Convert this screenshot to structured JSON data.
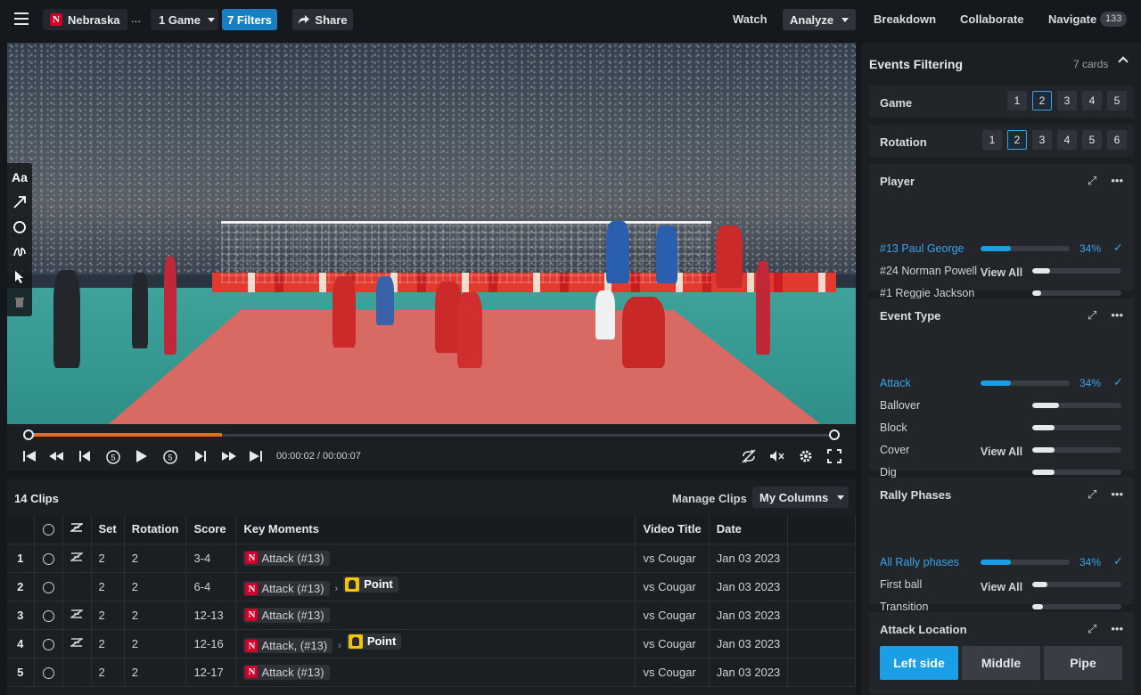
{
  "topbar": {
    "team": "Nebraska",
    "more": "...",
    "game_label": "1 Game",
    "filters_label": "7 Filters",
    "share_label": "Share",
    "nav": {
      "watch": "Watch",
      "analyze": "Analyze",
      "breakdown": "Breakdown",
      "collaborate": "Collaborate",
      "navigate": "Navigate",
      "navigate_count": "133"
    }
  },
  "player_controls": {
    "time": "00:00:02 / 00:00:07",
    "progress": 0.24
  },
  "drawtools": {
    "text_tool": "Aa"
  },
  "clips": {
    "title": "14 Clips",
    "manage_label": "Manage Clips",
    "columns_label": "My Columns",
    "headers": [
      "Set",
      "Rotation",
      "Score",
      "Key Moments",
      "Video Title",
      "Date"
    ],
    "rows": [
      {
        "n": "1",
        "set": "2",
        "rotation": "2",
        "score": "3-4",
        "moment": "Attack (#13)",
        "point": "",
        "title": "vs Cougar",
        "date": "Jan 03 2023",
        "marker": true
      },
      {
        "n": "2",
        "set": "2",
        "rotation": "2",
        "score": "6-4",
        "moment": "Attack (#13)",
        "point": "Point",
        "title": "vs Cougar",
        "date": "Jan 03 2023",
        "marker": false
      },
      {
        "n": "3",
        "set": "2",
        "rotation": "2",
        "score": "12-13",
        "moment": "Attack (#13)",
        "point": "",
        "title": "vs Cougar",
        "date": "Jan 03 2023",
        "marker": true
      },
      {
        "n": "4",
        "set": "2",
        "rotation": "2",
        "score": "12-16",
        "moment": "Attack, (#13)",
        "point": "Point",
        "title": "vs Cougar",
        "date": "Jan 03 2023",
        "marker": true
      },
      {
        "n": "5",
        "set": "2",
        "rotation": "2",
        "score": "12-17",
        "moment": "Attack (#13)",
        "point": "",
        "title": "vs Cougar",
        "date": "Jan 03 2023",
        "marker": false
      }
    ]
  },
  "filtering": {
    "title": "Events Filtering",
    "count": "7 cards",
    "game": {
      "label": "Game",
      "options": [
        "1",
        "2",
        "3",
        "4",
        "5"
      ],
      "selected": "2"
    },
    "rotation": {
      "label": "Rotation",
      "options": [
        "1",
        "2",
        "3",
        "4",
        "5",
        "6"
      ],
      "selected": "2"
    },
    "player": {
      "label": "Player",
      "items": [
        {
          "label": "#13 Paul George",
          "pct": "34%",
          "value": 0.34,
          "active": true
        },
        {
          "label": "#24 Norman Powell",
          "value": 0.2,
          "active": false
        },
        {
          "label": "#1 Reggie Jackson",
          "value": 0.1,
          "active": false
        }
      ],
      "view_all": "View All"
    },
    "event_type": {
      "label": "Event Type",
      "items": [
        {
          "label": "Attack",
          "pct": "34%",
          "value": 0.34,
          "active": true
        },
        {
          "label": "Ballover",
          "value": 0.3,
          "active": false
        },
        {
          "label": "Block",
          "value": 0.25,
          "active": false
        },
        {
          "label": "Cover",
          "value": 0.25,
          "active": false
        },
        {
          "label": "Dig",
          "value": 0.25,
          "active": false
        }
      ],
      "view_all": "View All"
    },
    "rally_phases": {
      "label": "Rally Phases",
      "items": [
        {
          "label": "All Rally phases",
          "pct": "34%",
          "value": 0.34,
          "active": true
        },
        {
          "label": "First ball",
          "value": 0.17,
          "active": false
        },
        {
          "label": "Transition",
          "value": 0.12,
          "active": false
        }
      ],
      "view_all": "View All"
    },
    "attack_location": {
      "label": "Attack Location",
      "options": [
        "Left side",
        "Middle",
        "Pipe"
      ],
      "selected": "Left side"
    }
  }
}
